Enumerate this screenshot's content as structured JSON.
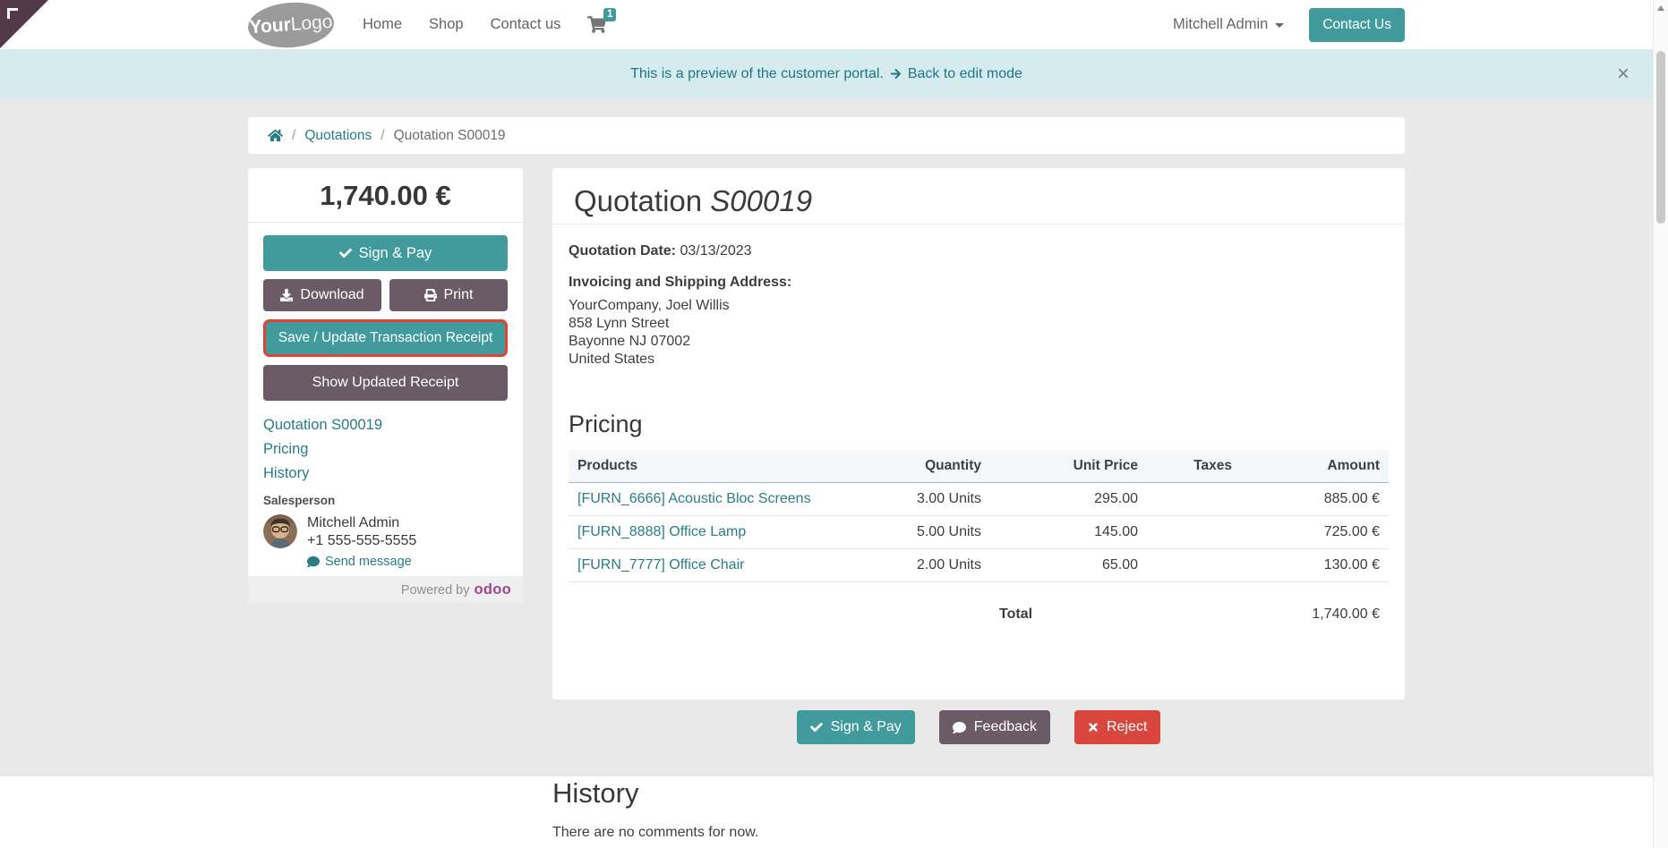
{
  "navbar": {
    "logo_part1": "Your",
    "logo_part2": "Logo",
    "links": [
      "Home",
      "Shop",
      "Contact us"
    ],
    "cart_badge": "1",
    "user_menu_label": "Mitchell Admin",
    "contact_us_label": "Contact Us"
  },
  "banner": {
    "message": "This is a preview of the customer portal.",
    "back_link": "Back to edit mode",
    "close_label": "×"
  },
  "breadcrumb": {
    "separator": "/",
    "quotations": "Quotations",
    "current": "Quotation S00019"
  },
  "sidebar": {
    "amount_due": "1,740.00 €",
    "sign_pay_label": "Sign & Pay",
    "download_label": "Download",
    "print_label": "Print",
    "save_update_label": "Save / Update Transaction Receipt",
    "show_receipt_label": "Show Updated Receipt",
    "nav_links": [
      "Quotation S00019",
      "Pricing",
      "History"
    ],
    "salesperson_label": "Salesperson",
    "salesperson_name": "Mitchell Admin",
    "salesperson_phone": "+1 555-555-5555",
    "send_message_label": "Send message",
    "powered_by": "Powered by",
    "odoo_brand": "odoo"
  },
  "quotation": {
    "title_prefix": "Quotation",
    "title_number": "S00019",
    "date_label": "Quotation Date:",
    "date_value": "03/13/2023",
    "address_label": "Invoicing and Shipping Address:",
    "address_lines": [
      "YourCompany, Joel Willis",
      "858 Lynn Street",
      "Bayonne NJ 07002",
      "United States"
    ],
    "pricing_heading": "Pricing",
    "table": {
      "headers": [
        "Products",
        "Quantity",
        "Unit Price",
        "Taxes",
        "Amount"
      ],
      "rows": [
        {
          "product": "[FURN_6666] Acoustic Bloc Screens",
          "quantity": "3.00 Units",
          "unit_price": "295.00",
          "taxes": "",
          "amount": "885.00 €"
        },
        {
          "product": "[FURN_8888] Office Lamp",
          "quantity": "5.00 Units",
          "unit_price": "145.00",
          "taxes": "",
          "amount": "725.00 €"
        },
        {
          "product": "[FURN_7777] Office Chair",
          "quantity": "2.00 Units",
          "unit_price": "65.00",
          "taxes": "",
          "amount": "130.00 €"
        }
      ],
      "total_label": "Total",
      "total_value": "1,740.00 €"
    }
  },
  "actions": {
    "sign_pay": "Sign & Pay",
    "feedback": "Feedback",
    "reject": "Reject"
  },
  "history": {
    "heading": "History",
    "empty_message": "There are no comments for now."
  },
  "colors": {
    "accent_teal": "#419b9c",
    "link_teal": "#2a7d85",
    "mauve_button": "#6a5b66",
    "danger_red": "#d9463e",
    "highlight_border": "#e5422d",
    "banner_bg": "#d6ebee",
    "page_bg": "#e9e9e9",
    "odoo_magenta": "#a24689"
  }
}
